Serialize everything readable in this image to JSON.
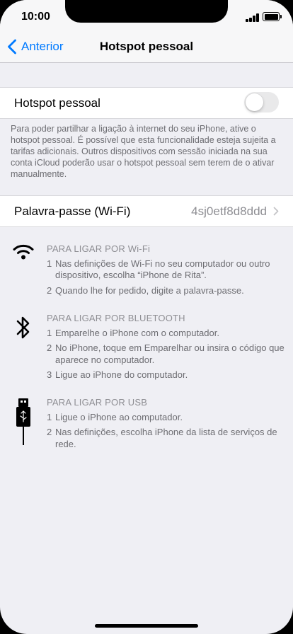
{
  "status": {
    "time": "10:00"
  },
  "nav": {
    "back_label": "Anterior",
    "title": "Hotspot pessoal"
  },
  "hotspot": {
    "label": "Hotspot pessoal",
    "enabled": false,
    "footer": "Para poder partilhar a ligação à internet do seu iPhone, ative o hotspot pessoal. É possível que esta funcionalidade esteja sujeita a tarifas adicionais. Outros dispositivos com sessão iniciada na sua conta iCloud poderão usar o hotspot pessoal sem terem de o ativar manualmente."
  },
  "password": {
    "label": "Palavra-passe (Wi-Fi)",
    "value": "4sj0etf8d8ddd"
  },
  "instructions": [
    {
      "icon": "wifi-icon",
      "heading": "PARA LIGAR POR Wi-Fi",
      "steps": [
        {
          "num": "1",
          "text": "Nas definições de Wi-Fi no seu computador ou outro dispositivo, escolha “iPhone de Rita”."
        },
        {
          "num": "2",
          "text": "Quando lhe for pedido, digite a palavra-passe."
        }
      ]
    },
    {
      "icon": "bluetooth-icon",
      "heading": "PARA LIGAR POR BLUETOOTH",
      "steps": [
        {
          "num": "1",
          "text": "Emparelhe o iPhone com o computador."
        },
        {
          "num": "2",
          "text": "No iPhone, toque em Emparelhar ou insira o código que aparece no computador."
        },
        {
          "num": "3",
          "text": "Ligue ao iPhone do computador."
        }
      ]
    },
    {
      "icon": "usb-cable-icon",
      "heading": "PARA LIGAR POR USB",
      "steps": [
        {
          "num": "1",
          "text": "Ligue o iPhone ao computador."
        },
        {
          "num": "2",
          "text": "Nas definições, escolha iPhone da lista de serviços de rede."
        }
      ]
    }
  ],
  "colors": {
    "accent": "#007aff",
    "background": "#efeff4",
    "secondary_text": "#6d6d72"
  }
}
